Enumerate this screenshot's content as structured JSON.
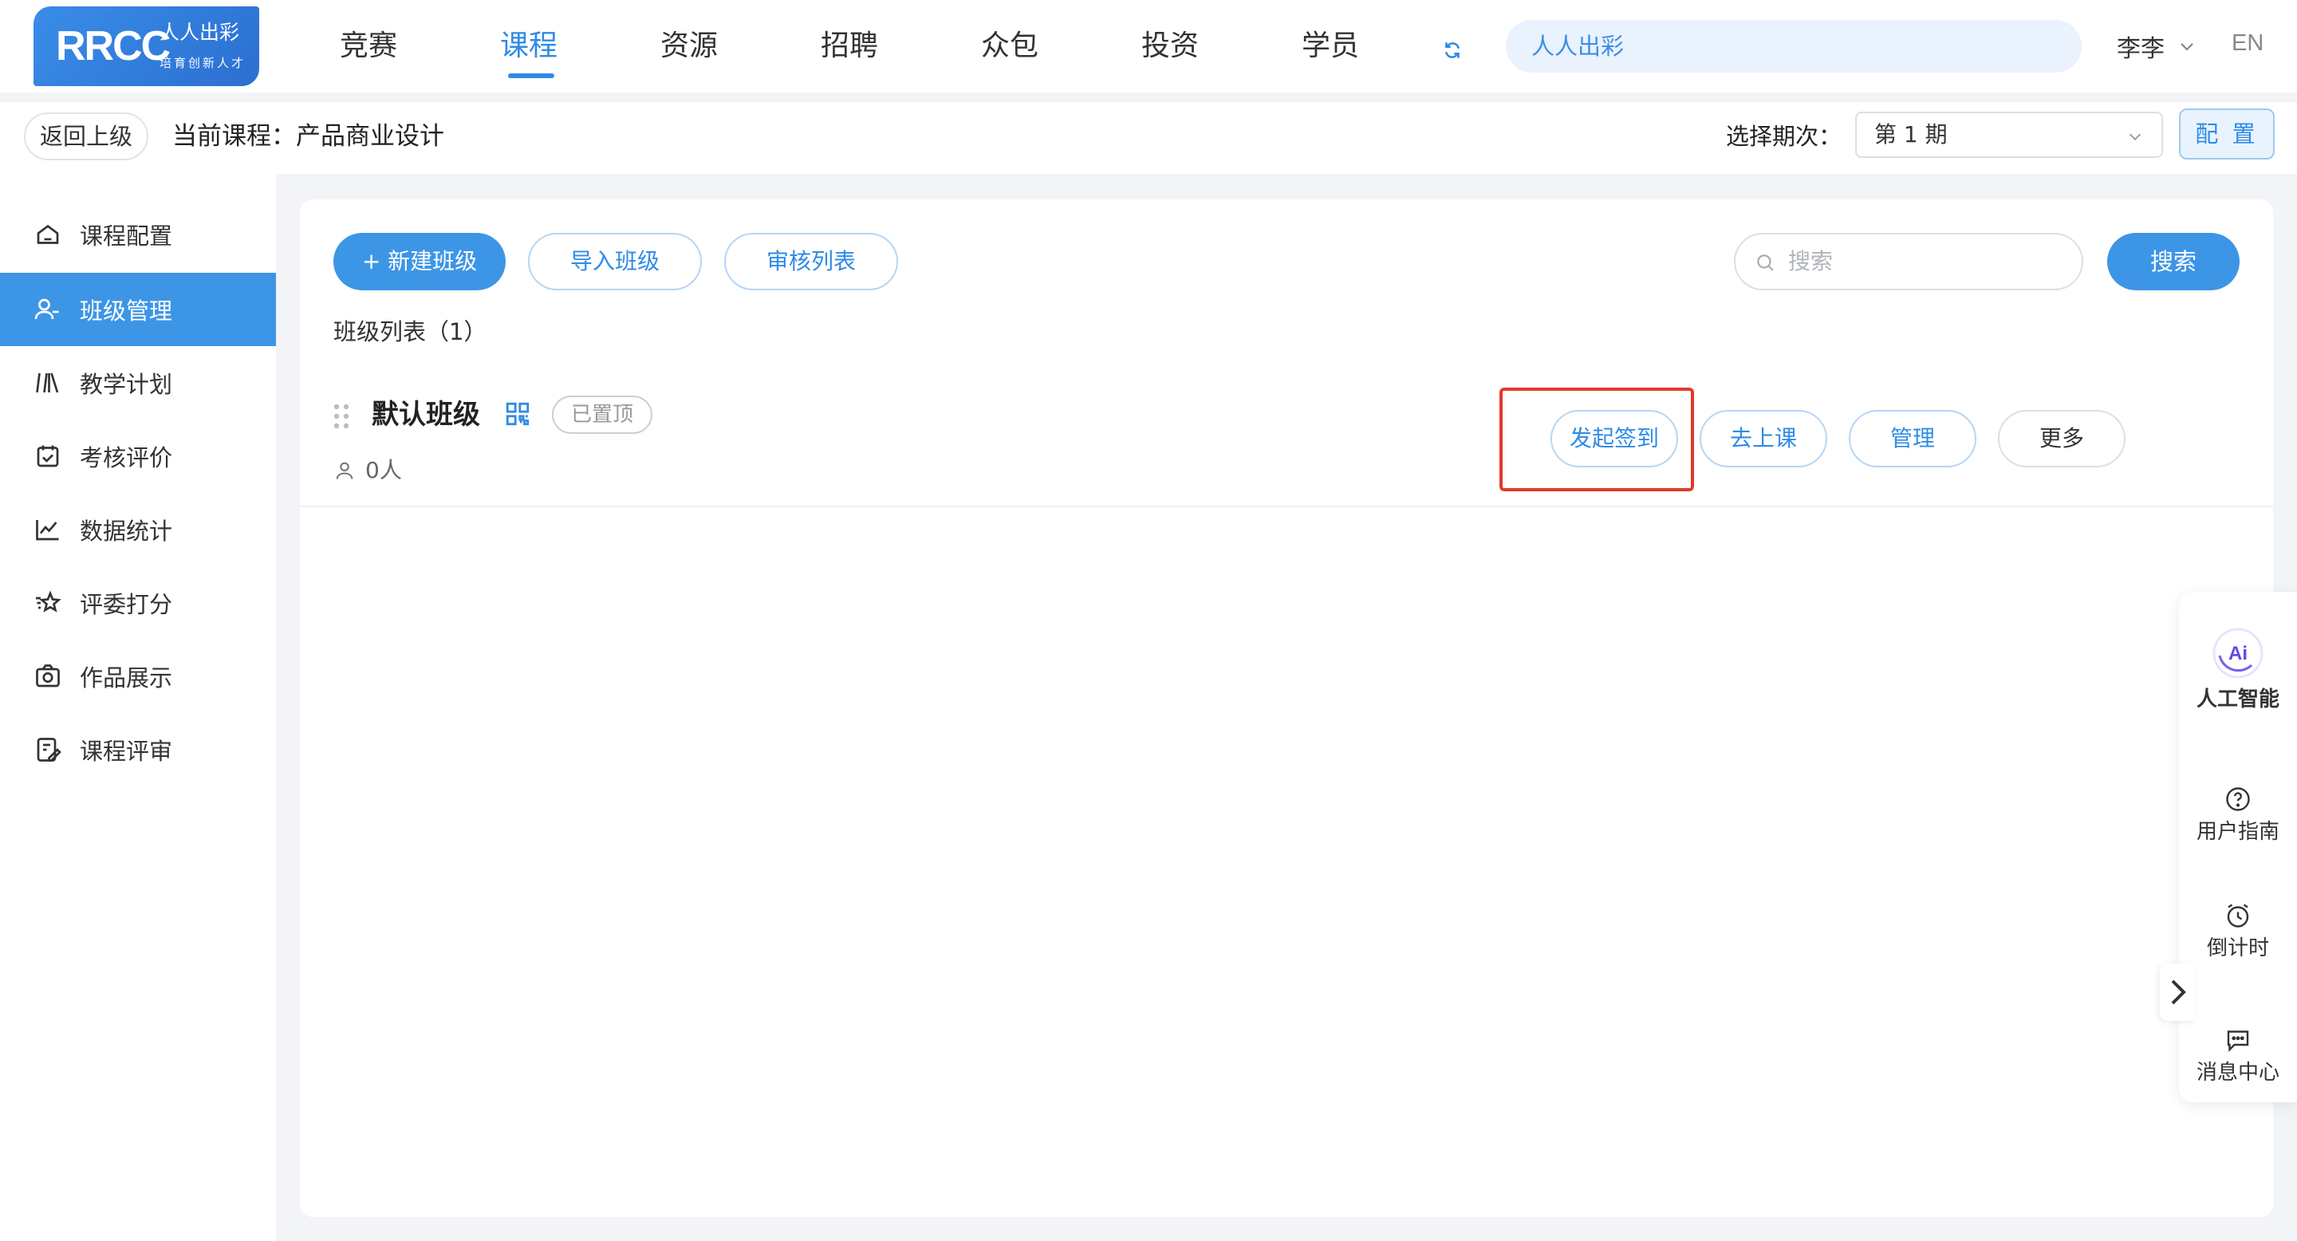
{
  "brand": {
    "mark": "RRCC",
    "name_cn": "人人出彩",
    "slogan": "培育创新人才",
    "colors": {
      "accent": "#2f8be6",
      "highlight": "#e0392b"
    }
  },
  "nav": {
    "items": [
      "竞赛",
      "课程",
      "资源",
      "招聘",
      "众包",
      "投资",
      "学员"
    ],
    "active": "课程",
    "refresh_icon": "refresh-icon",
    "search_value": "人人出彩",
    "user_name": "李李",
    "lang": "EN"
  },
  "subheader": {
    "back_label": "返回上级",
    "current_course": "当前课程：产品商业设计",
    "period_label": "选择期次：",
    "period_value": "第 1 期",
    "config_label": "配 置"
  },
  "sidebar": {
    "items": [
      {
        "label": "课程配置",
        "icon": "home-icon"
      },
      {
        "label": "班级管理",
        "icon": "user-group-icon",
        "active": true
      },
      {
        "label": "教学计划",
        "icon": "plan-icon"
      },
      {
        "label": "考核评价",
        "icon": "calendar-check-icon"
      },
      {
        "label": "数据统计",
        "icon": "line-chart-icon"
      },
      {
        "label": "评委打分",
        "icon": "star-icon"
      },
      {
        "label": "作品展示",
        "icon": "camera-icon"
      },
      {
        "label": "课程评审",
        "icon": "review-icon"
      }
    ]
  },
  "toolbar": {
    "new_class": "+ 新建班级",
    "import_class": "导入班级",
    "review_list": "审核列表",
    "search_placeholder": "搜索",
    "search_button": "搜索"
  },
  "class_list": {
    "title": "班级列表（1）",
    "rows": [
      {
        "name": "默认班级",
        "badge": "已置顶",
        "members": "0人",
        "actions": [
          "发起签到",
          "去上课",
          "管理",
          "更多"
        ]
      }
    ]
  },
  "float_panel": {
    "ai_badge": "Ai",
    "ai_label": "人工智能",
    "items": [
      "用户指南",
      "倒计时",
      "消息中心"
    ]
  }
}
